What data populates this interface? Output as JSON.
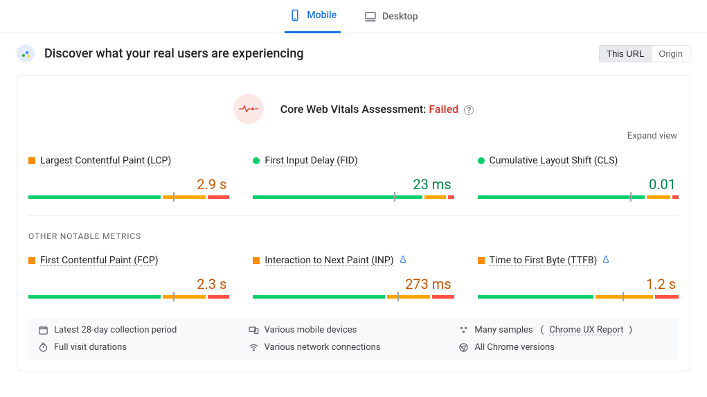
{
  "tabs": {
    "mobile": "Mobile",
    "desktop": "Desktop"
  },
  "header": {
    "title": "Discover what your real users are experiencing",
    "seg_url": "This URL",
    "seg_origin": "Origin"
  },
  "assessment": {
    "label": "Core Web Vitals Assessment: ",
    "status": "Failed",
    "expand": "Expand view"
  },
  "metrics": {
    "lcp": {
      "name": "Largest Contentful Paint (LCP)",
      "value": "2.9 s"
    },
    "fid": {
      "name": "First Input Delay (FID)",
      "value": "23 ms"
    },
    "cls": {
      "name": "Cumulative Layout Shift (CLS)",
      "value": "0.01"
    }
  },
  "other_title": "OTHER NOTABLE METRICS",
  "other": {
    "fcp": {
      "name": "First Contentful Paint (FCP)",
      "value": "2.3 s"
    },
    "inp": {
      "name": "Interaction to Next Paint (INP)",
      "value": "273 ms"
    },
    "ttfb": {
      "name": "Time to First Byte (TTFB)",
      "value": "1.2 s"
    }
  },
  "footer": {
    "period": "Latest 28-day collection period",
    "devices": "Various mobile devices",
    "samples": "Many samples",
    "samples_link": "Chrome UX Report",
    "duration": "Full visit durations",
    "network": "Various network connections",
    "chrome": "All Chrome versions"
  },
  "colors": {
    "green": "#0cce6b",
    "orange": "#ffa400",
    "red": "#ff4e42"
  },
  "chart_data": [
    {
      "type": "bar",
      "metric": "LCP",
      "title": "Largest Contentful Paint (LCP)",
      "unit": "s",
      "value": 2.9,
      "status": "needs-improvement",
      "distribution": {
        "good": 67,
        "needs_improvement": 22,
        "poor": 11
      },
      "thresholds": {
        "good_max": 2.5,
        "poor_min": 4.0
      }
    },
    {
      "type": "bar",
      "metric": "FID",
      "title": "First Input Delay (FID)",
      "unit": "ms",
      "value": 23,
      "status": "good",
      "distribution": {
        "good": 86,
        "needs_improvement": 11,
        "poor": 3
      },
      "thresholds": {
        "good_max": 100,
        "poor_min": 300
      }
    },
    {
      "type": "bar",
      "metric": "CLS",
      "title": "Cumulative Layout Shift (CLS)",
      "unit": "",
      "value": 0.01,
      "status": "good",
      "distribution": {
        "good": 85,
        "needs_improvement": 12,
        "poor": 3
      },
      "thresholds": {
        "good_max": 0.1,
        "poor_min": 0.25
      }
    },
    {
      "type": "bar",
      "metric": "FCP",
      "title": "First Contentful Paint (FCP)",
      "unit": "s",
      "value": 2.3,
      "status": "needs-improvement",
      "distribution": {
        "good": 67,
        "needs_improvement": 22,
        "poor": 11
      },
      "thresholds": {
        "good_max": 1.8,
        "poor_min": 3.0
      }
    },
    {
      "type": "bar",
      "metric": "INP",
      "title": "Interaction to Next Paint (INP)",
      "unit": "ms",
      "value": 273,
      "status": "needs-improvement",
      "distribution": {
        "good": 67,
        "needs_improvement": 22,
        "poor": 11
      },
      "thresholds": {
        "good_max": 200,
        "poor_min": 500
      },
      "experimental": true
    },
    {
      "type": "bar",
      "metric": "TTFB",
      "title": "Time to First Byte (TTFB)",
      "unit": "s",
      "value": 1.2,
      "status": "needs-improvement",
      "distribution": {
        "good": 59,
        "needs_improvement": 29,
        "poor": 12
      },
      "thresholds": {
        "good_max": 0.8,
        "poor_min": 1.8
      },
      "experimental": true
    }
  ]
}
